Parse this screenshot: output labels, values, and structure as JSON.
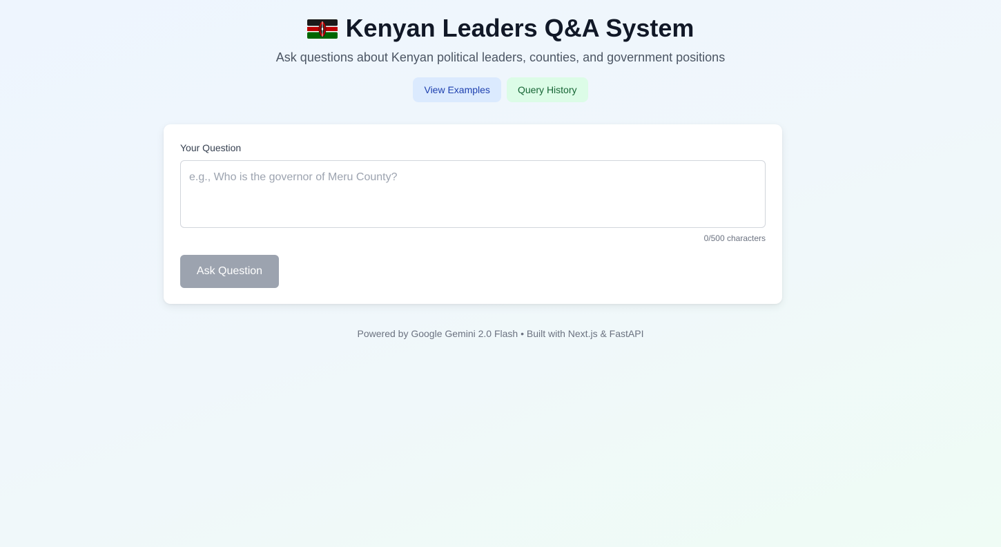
{
  "header": {
    "flag_icon": "kenya-flag-icon",
    "title": "Kenyan Leaders Q&A System",
    "subtitle": "Ask questions about Kenyan political leaders, counties, and government positions"
  },
  "actions": {
    "examples_label": "View Examples",
    "history_label": "Query History"
  },
  "form": {
    "label": "Your Question",
    "placeholder": "e.g., Who is the governor of Meru County?",
    "value": "",
    "char_count": "0/500 characters",
    "submit_label": "Ask Question"
  },
  "footer": {
    "text": "Powered by Google Gemini 2.0 Flash • Built with Next.js & FastAPI"
  },
  "colors": {
    "examples_bg": "#dbeafe",
    "examples_text": "#1e40af",
    "history_bg": "#dcfce7",
    "history_text": "#166534",
    "submit_disabled": "#9ca3af"
  }
}
